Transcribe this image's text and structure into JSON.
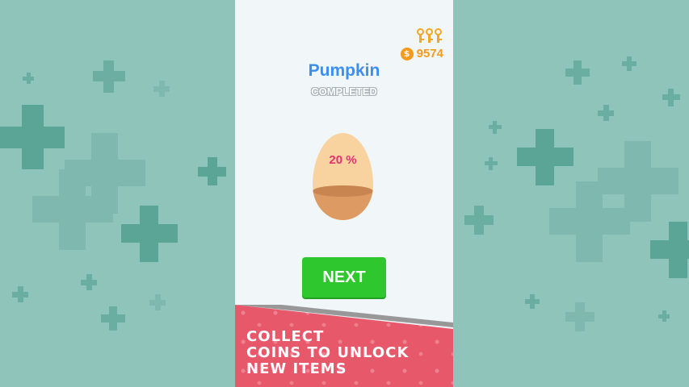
{
  "hud": {
    "keys_count": 3,
    "coin_symbol": "$",
    "coins": "9574",
    "key_icon": "key-icon",
    "coin_icon": "coin-icon"
  },
  "level": {
    "name": "Pumpkin",
    "status": "COMPLETED"
  },
  "egg": {
    "progress_label": "20 %",
    "progress": 0.2
  },
  "buttons": {
    "next_label": "NEXT"
  },
  "banner": {
    "line1": "COLLECT",
    "line2": "COINS TO UNLOCK",
    "line3": "NEW ITEMS"
  },
  "colors": {
    "background": "#8fc4bb",
    "panel": "#f1f6f8",
    "title_blue": "#3b8ff0",
    "coin_orange": "#f59a1e",
    "next_green": "#2ec82e",
    "progress_pink": "#e0336f",
    "banner_red": "#e8586b",
    "egg": "#f8d39f"
  }
}
